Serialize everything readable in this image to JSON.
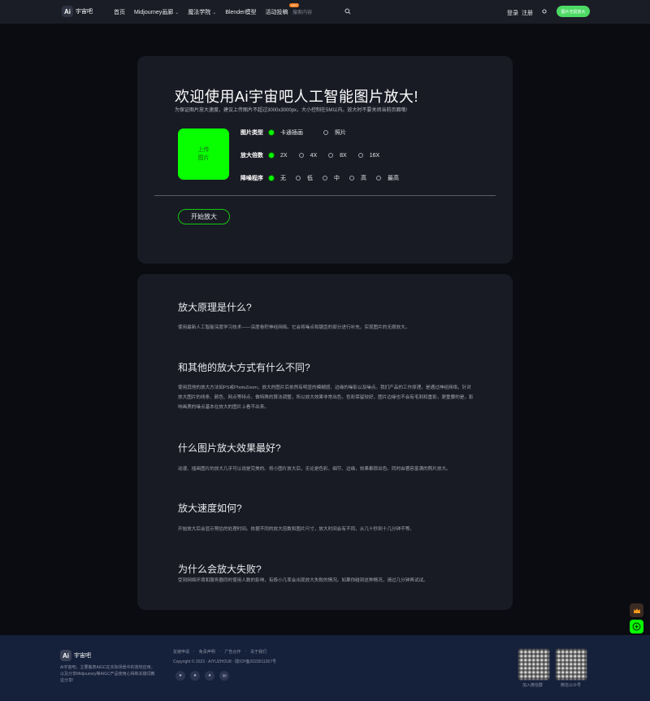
{
  "header": {
    "logo_mark": "Ai",
    "logo_text": "宇宙吧",
    "nav": [
      {
        "label": "首页",
        "chevron": false
      },
      {
        "label": "Midjourney画廊",
        "chevron": true
      },
      {
        "label": "魔法学院",
        "chevron": true
      },
      {
        "label": "Blender模型",
        "chevron": false
      },
      {
        "label": "活动投稿",
        "chevron": true,
        "badge": "HOT"
      }
    ],
    "search_placeholder": "搜索内容",
    "login": "登录",
    "register": "注册",
    "cta": "图片无损放大"
  },
  "upscale": {
    "title": "欢迎使用Ai宇宙吧人工智能图片放大!",
    "subtitle": "为保证图片放大速度，建议上传图片不超过3000x3000px，大小控制在5M以内。放大时不要关闭当前页面哦!",
    "upload_line1": "上传",
    "upload_line2": "图片",
    "rows": [
      {
        "label": "图片类型",
        "options": [
          "卡通插画",
          "照片"
        ],
        "selected": 0
      },
      {
        "label": "放大倍数",
        "options": [
          "2X",
          "4X",
          "8X",
          "16X"
        ],
        "selected": 0
      },
      {
        "label": "降噪程序",
        "options": [
          "无",
          "低",
          "中",
          "高",
          "最高"
        ],
        "selected": 0
      }
    ],
    "start_button": "开始放大"
  },
  "faq": [
    {
      "q": "放大原理是什么?",
      "a": "使用最新人工智能深度学习技术——深度卷积神经网络。它会将噪点和锯齿的部分进行补充，实现图片的无损放大。"
    },
    {
      "q": "和其他的放大方式有什么不同?",
      "a": "使用其他的放大方法如PS或PhotoZoom，放大的图片后依然有明显的模糊感、边缘的噪影以及噪点。我们产品的工作原理，是通过神经网络，针对放大图片的线条、颜色、网点等特点，做特殊的算法调整，所以放大效果非常出色，色彩保留较好，图片边缘也不会有毛刺和重影，更重要的是，影响画质的噪点基本在放大的图片上看不出来。"
    },
    {
      "q": "什么图片放大效果最好?",
      "a": "动漫、插画图片的放大几乎可以说是完美的。将小图片放大后，无论是色彩、细节、边缘，效果都很出色。同时由著容富满的照片放大。"
    },
    {
      "q": "放大速度如何?",
      "a": "开始放大后会显示预估的处理时间。依据不同的放大倍数和图片尺寸，放大时间会有不同，从几十秒到十几分钟不等。"
    },
    {
      "q": "为什么会放大失败?",
      "a": "受到网络环境和服务器同时使用人数的影响，有极小几率会出现放大失败的情况。如果你碰到这种情况，请过几分钟再试试。"
    }
  ],
  "footer": {
    "logo_mark": "Ai",
    "logo_text": "宇宙吧",
    "desc": "Ai宇宙吧，主要搬表AIGC在实际场景中的落地应用，以及分享Midjourney等AIGC产品使用心得和关键词教这分享!",
    "links": [
      "友链申请",
      "免责声明",
      "广告合作",
      "关于我们"
    ],
    "copyright": "Copyright © 2023 · AIYUZHOU8 · 陇ICP备2023011267号",
    "qr1_label": "加入微信群",
    "qr2_label": "微信公众号"
  },
  "colors": {
    "accent": "#07ff00",
    "cta": "#4cd964",
    "panel": "#191b24",
    "footer": "#15203a"
  }
}
